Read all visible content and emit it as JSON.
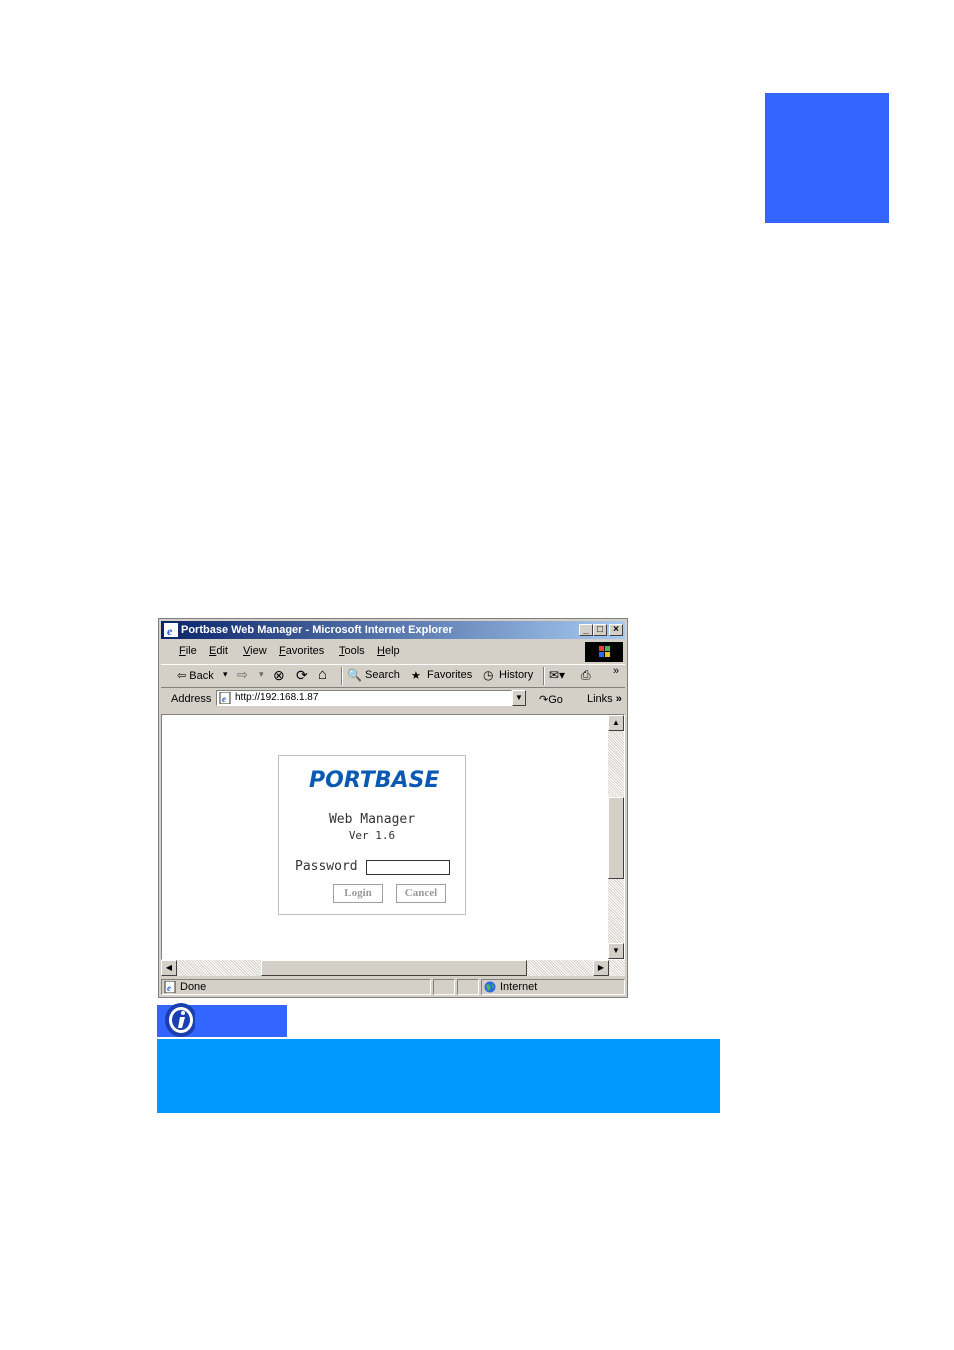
{
  "colors": {
    "chapter_block": "#3366ff",
    "note_tab": "#3366ff",
    "note_band": "#0099ff",
    "logo": "#0a5ab4"
  },
  "browser": {
    "title": "Portbase Web Manager - Microsoft Internet Explorer",
    "window_buttons": [
      "_",
      "□",
      "×"
    ],
    "menu": [
      {
        "key": "F",
        "rest": "ile"
      },
      {
        "key": "E",
        "rest": "dit"
      },
      {
        "key": "V",
        "rest": "iew"
      },
      {
        "key": "F",
        "rest": "avorites"
      },
      {
        "key": "T",
        "rest": "ools"
      },
      {
        "key": "H",
        "rest": "elp"
      }
    ],
    "toolbar": {
      "back": "⇦ Back",
      "back_dd": "▾",
      "forward": "⇨",
      "forward_dd": "▾",
      "stop": "⊗",
      "refresh": "⟳",
      "home": "⌂",
      "search": "Search",
      "favorites": "Favorites",
      "history": "History",
      "more": "»"
    },
    "address": {
      "label": "Address",
      "url": "http://192.168.1.87",
      "go": "Go",
      "links": "Links"
    },
    "status": {
      "text": "Done",
      "zone": "Internet"
    },
    "scroll": {
      "up": "▲",
      "down": "▼",
      "left": "◀",
      "right": "▶"
    }
  },
  "login": {
    "logo": "PORTBASE",
    "title": "Web Manager",
    "version": "Ver 1.6",
    "password_label": "Password",
    "password_value": "",
    "login_button": "Login",
    "cancel_button": "Cancel"
  }
}
